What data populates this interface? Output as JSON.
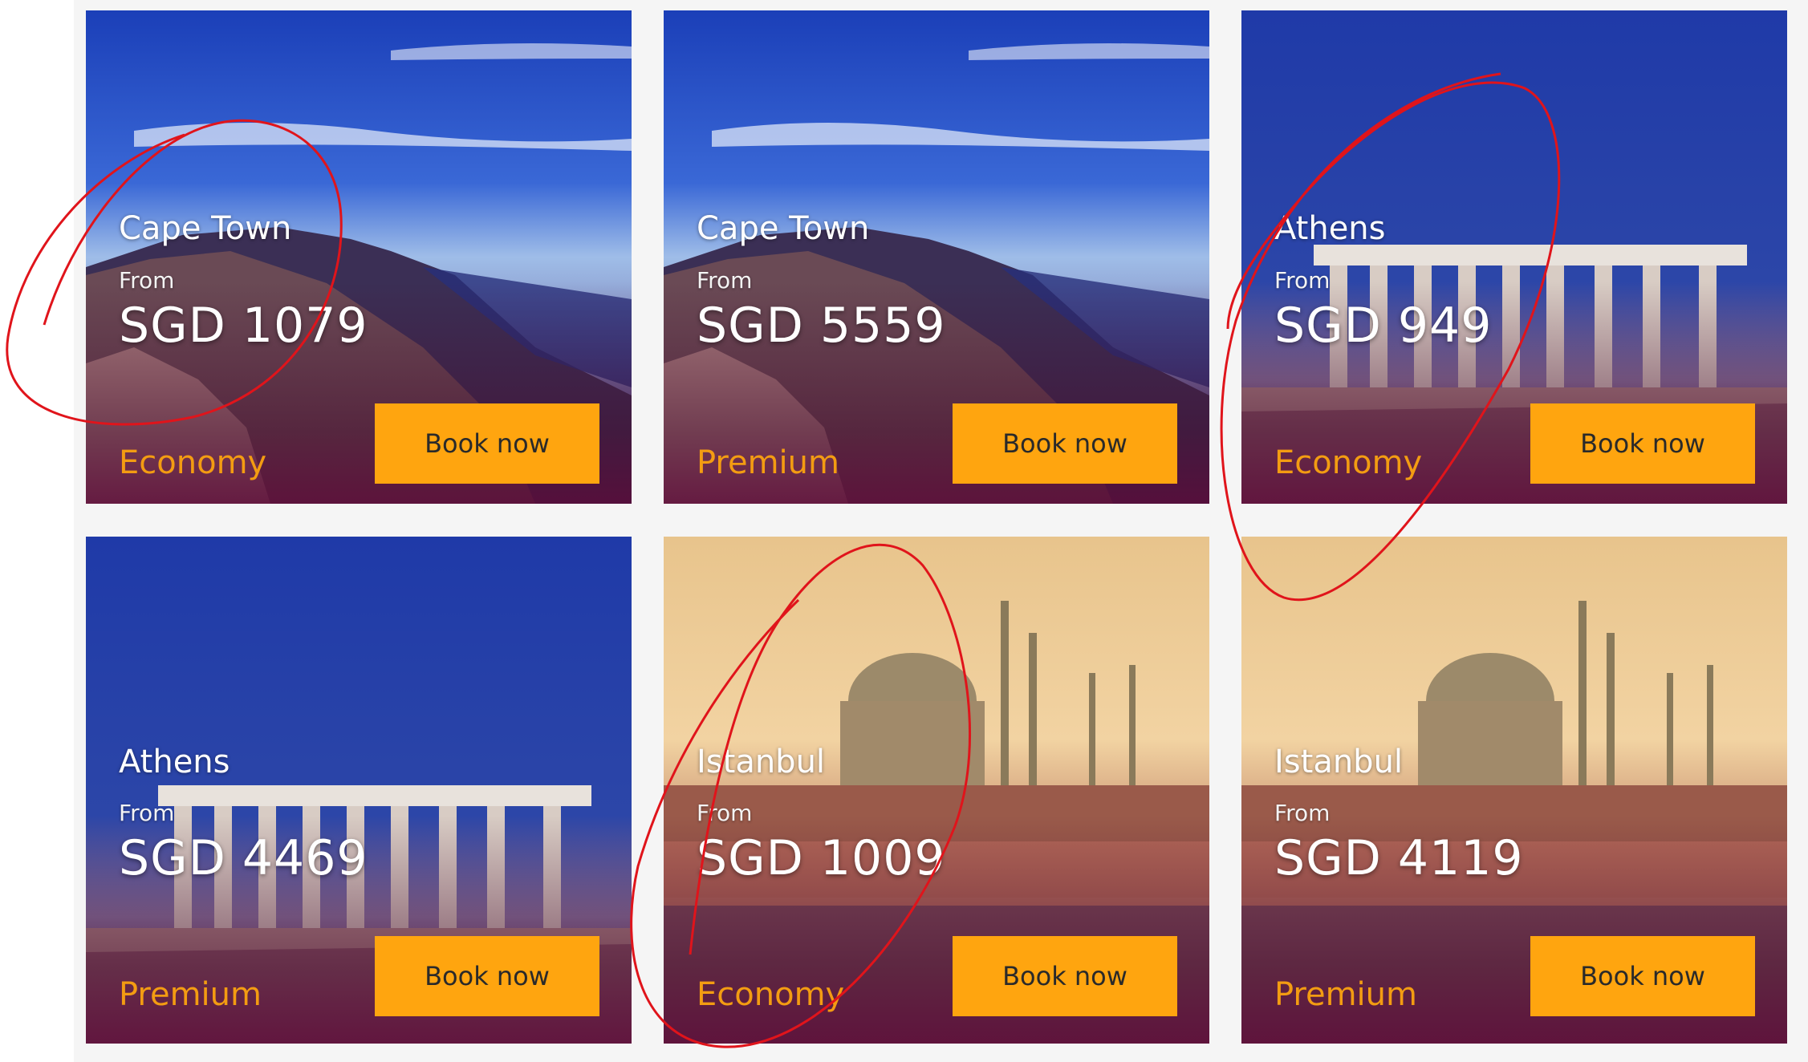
{
  "cards": [
    {
      "city": "Cape Town",
      "from": "From",
      "price": "SGD 1079",
      "cabin": "Economy",
      "button": "Book now",
      "scene": "cape-town"
    },
    {
      "city": "Cape Town",
      "from": "From",
      "price": "SGD 5559",
      "cabin": "Premium",
      "button": "Book now",
      "scene": "cape-town"
    },
    {
      "city": "Athens",
      "from": "From",
      "price": "SGD 949",
      "cabin": "Economy",
      "button": "Book now",
      "scene": "athens"
    },
    {
      "city": "Athens",
      "from": "From",
      "price": "SGD 4469",
      "cabin": "Premium",
      "button": "Book now",
      "scene": "athens"
    },
    {
      "city": "Istanbul",
      "from": "From",
      "price": "SGD 1009",
      "cabin": "Economy",
      "button": "Book now",
      "scene": "istanbul"
    },
    {
      "city": "Istanbul",
      "from": "From",
      "price": "SGD 4119",
      "cabin": "Premium",
      "button": "Book now",
      "scene": "istanbul"
    }
  ],
  "colors": {
    "button": "#ffa50f",
    "cabin_text": "#f39c12",
    "annotation": "#e0141b"
  }
}
